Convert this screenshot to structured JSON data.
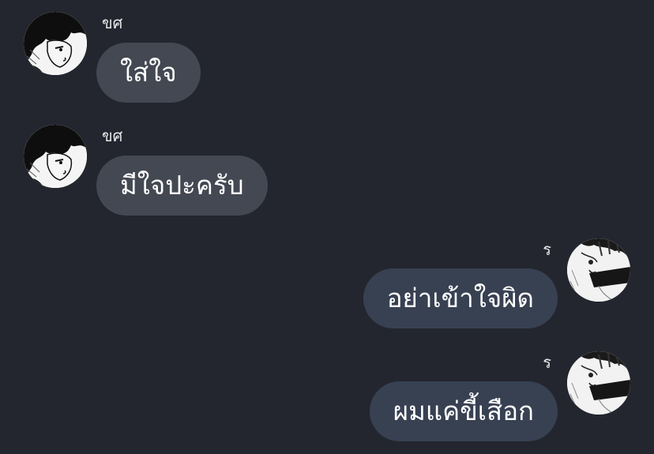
{
  "conversation": {
    "messages": [
      {
        "direction": "incoming",
        "sender": "ขศ",
        "avatar": "manga-boy-dark-hair-avatar",
        "text": "ใส่ใจ"
      },
      {
        "direction": "incoming",
        "sender": "ขศ",
        "avatar": "manga-boy-dark-hair-avatar",
        "text": "มีใจปะครับ"
      },
      {
        "direction": "outgoing",
        "sender": "ร",
        "avatar": "manga-boy-choker-avatar",
        "text": "อย่าเข้าใจผิด"
      },
      {
        "direction": "outgoing",
        "sender": "ร",
        "avatar": "manga-boy-choker-avatar",
        "text": "ผมแค่ขี้เสือก"
      }
    ]
  },
  "colors": {
    "background": "#23262e",
    "incoming_bubble": "#444852",
    "outgoing_bubble": "#384152",
    "text": "#ffffff"
  }
}
